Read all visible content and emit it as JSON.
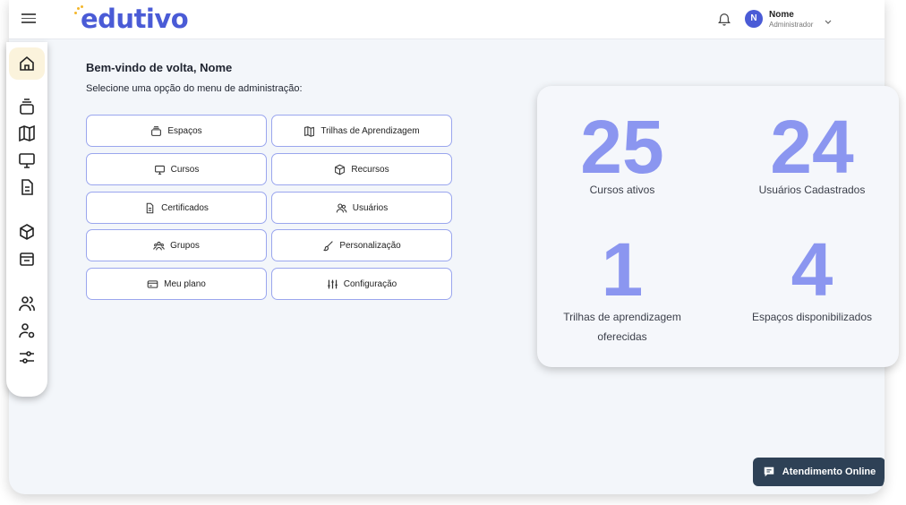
{
  "brand": {
    "logo_text": "edutivo",
    "accent": "#4a5bd6",
    "dot_color": "#f4b72c"
  },
  "header": {
    "avatar_initial": "N",
    "user_name": "Nome",
    "user_role": "Administrador"
  },
  "sidebar": {
    "items": [
      {
        "icon": "home-icon",
        "active": true
      },
      {
        "icon": "stack-icon"
      },
      {
        "icon": "map-icon"
      },
      {
        "icon": "monitor-icon"
      },
      {
        "icon": "document-icon"
      },
      {
        "icon": "cube-icon"
      },
      {
        "icon": "store-icon"
      },
      {
        "icon": "users-icon"
      },
      {
        "icon": "user-settings-icon"
      },
      {
        "icon": "sliders-icon"
      }
    ]
  },
  "main": {
    "welcome": "Bem-vindo de volta, Nome",
    "subtitle": "Selecione uma opção do menu de administração:",
    "buttons": [
      {
        "label": "Espaços",
        "icon": "stack-icon"
      },
      {
        "label": "Trilhas de Aprendizagem",
        "icon": "map-icon"
      },
      {
        "label": "Cursos",
        "icon": "monitor-icon"
      },
      {
        "label": "Recursos",
        "icon": "cube-icon"
      },
      {
        "label": "Certificados",
        "icon": "document-icon"
      },
      {
        "label": "Usuários",
        "icon": "users-icon"
      },
      {
        "label": "Grupos",
        "icon": "group-icon"
      },
      {
        "label": "Personalização",
        "icon": "brush-icon"
      },
      {
        "label": "Meu plano",
        "icon": "card-icon"
      },
      {
        "label": "Configuração",
        "icon": "sliders-icon"
      }
    ]
  },
  "stats": [
    {
      "value": "25",
      "label": "Cursos ativos"
    },
    {
      "value": "24",
      "label": "Usuários Cadastrados"
    },
    {
      "value": "1",
      "label_line1": "Trilhas de aprendizagem",
      "label_line2": "oferecidas"
    },
    {
      "value": "4",
      "label": "Espaços disponibilizados"
    }
  ],
  "support": {
    "label": "Atendimento Online",
    "icon": "chat-icon",
    "color": "#2e4156"
  }
}
